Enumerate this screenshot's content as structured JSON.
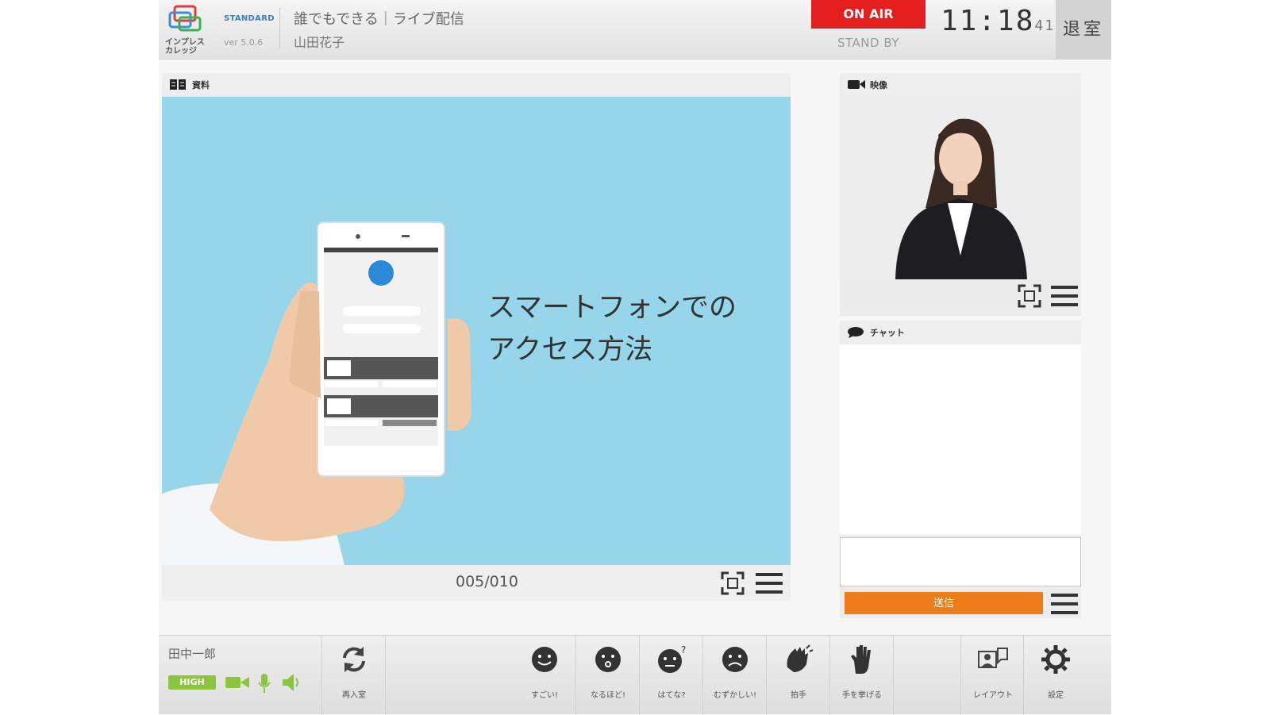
{
  "header": {
    "logo_text": "インプレス\nカレッジ",
    "edition": "STANDARD",
    "version": "ver 5.0.6",
    "lesson_title": "誰でもできる｜ライブ配信",
    "teacher": "山田花子",
    "onair_label": "ON AIR",
    "standby_label": "STAND BY",
    "clock_hm": "11:18",
    "clock_sec": "41",
    "exit_label": "退室"
  },
  "material": {
    "panel_label": "資料",
    "slide_lines": [
      "スマートフォンでの",
      "アクセス方法"
    ],
    "page": "005/010"
  },
  "video": {
    "panel_label": "映像"
  },
  "chat": {
    "panel_label": "チャット",
    "send_label": "送信",
    "input_value": ""
  },
  "toolbar": {
    "user_name": "田中一郎",
    "quality": "HIGH",
    "buttons": [
      "再入室",
      "すごい!",
      "なるほど!",
      "はてな?",
      "むずかしい!",
      "拍手",
      "手を挙げる",
      "レイアウト",
      "設定"
    ]
  },
  "colors": {
    "onair": "#e41e1e",
    "send": "#f07b1b",
    "quality": "#8bc53f",
    "slide_bg": "#97d6ea"
  }
}
